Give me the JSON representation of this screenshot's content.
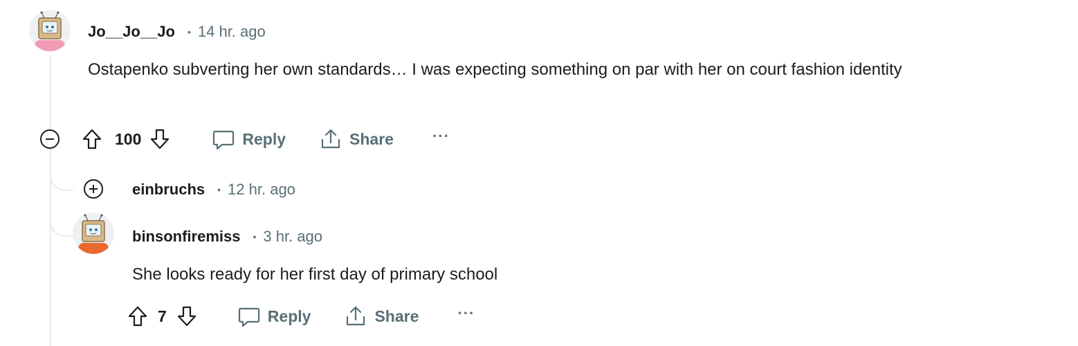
{
  "comments": [
    {
      "username": "Jo__Jo__Jo",
      "time": "14 hr. ago",
      "text": "Ostapenko subverting her own standards… I was expecting something on par with her on court fashion identity",
      "score": "100",
      "reply_label": "Reply",
      "share_label": "Share",
      "more_label": "···",
      "avatar_icon": "snoo-tv-head-avatar-icon"
    },
    {
      "username": "einbruchs",
      "time": "12 hr. ago",
      "collapsed": true
    },
    {
      "username": "binsonfiremiss",
      "time": "3 hr. ago",
      "text": "She looks ready for her first day of primary school",
      "score": "7",
      "reply_label": "Reply",
      "share_label": "Share",
      "more_label": "···",
      "avatar_icon": "snoo-tv-head-avatar-icon"
    }
  ],
  "separator": "•",
  "colors": {
    "text": "#1c1c1c",
    "meta": "#576f76",
    "thread_line": "#e5ebee",
    "background": "#ffffff"
  }
}
